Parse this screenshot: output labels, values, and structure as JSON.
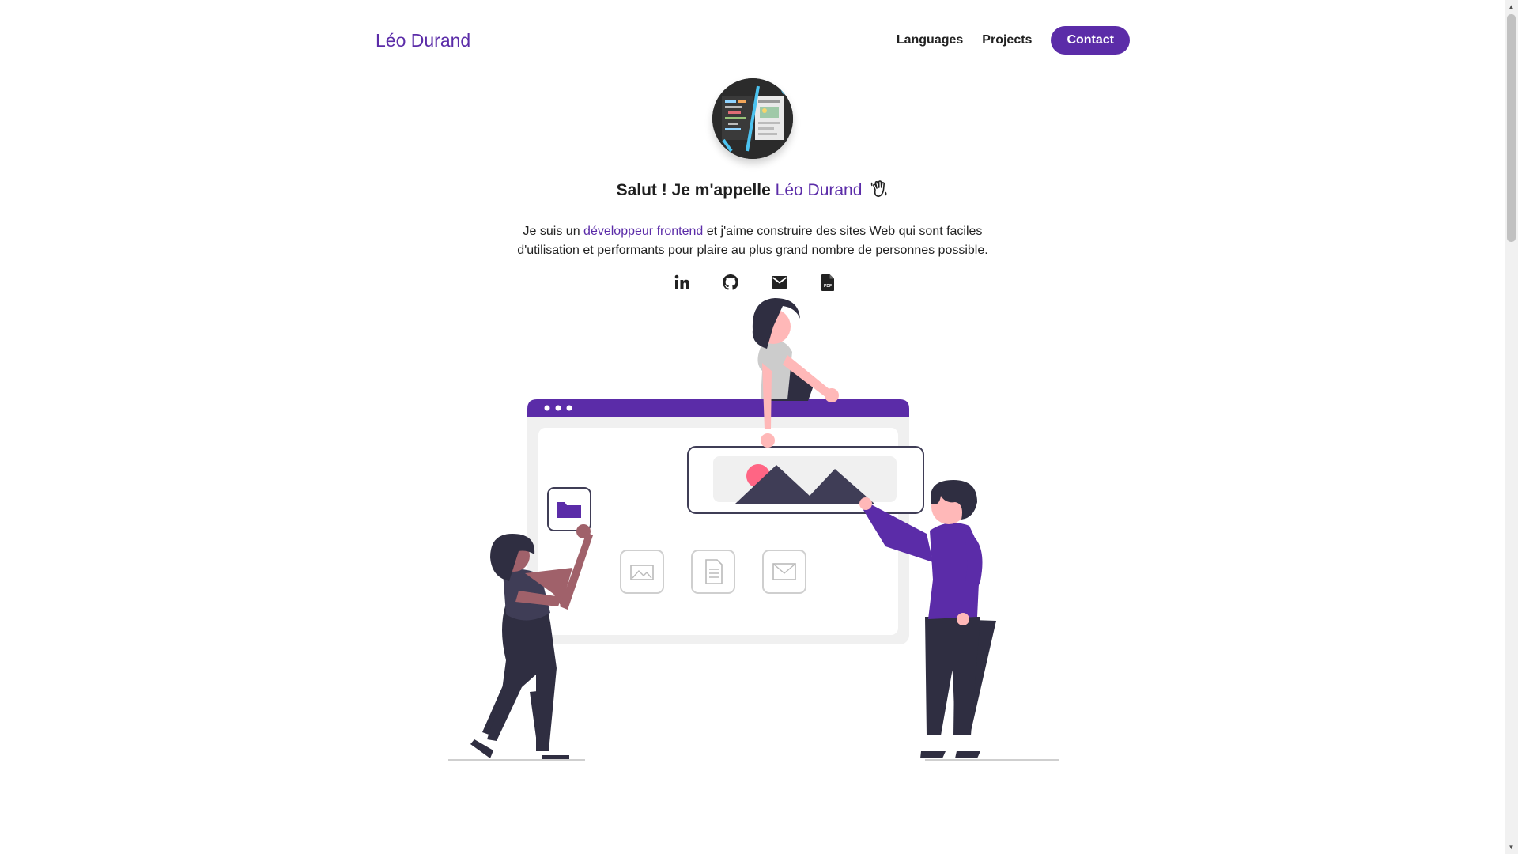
{
  "brand": {
    "name": "Léo Durand"
  },
  "nav": {
    "languages": "Languages",
    "projects": "Projects",
    "contact": "Contact"
  },
  "hero": {
    "greeting_prefix": "Salut ! Je m'appelle",
    "greeting_name": "Léo Durand",
    "bio_start": "Je suis un",
    "bio_highlight": "développeur frontend",
    "bio_end": "et j'aime construire des sites Web qui sont faciles d'utilisation et performants pour plaire au plus grand nombre de personnes possible."
  },
  "socials": [
    {
      "icon": "linkedin-icon"
    },
    {
      "icon": "github-icon"
    },
    {
      "icon": "email-icon"
    },
    {
      "icon": "pdf-cv-icon"
    }
  ],
  "colors": {
    "accent": "#5b2ca8",
    "text": "#1f1f1f",
    "illustration_dark": "#3f3d56",
    "illustration_pink": "#ff6584"
  }
}
